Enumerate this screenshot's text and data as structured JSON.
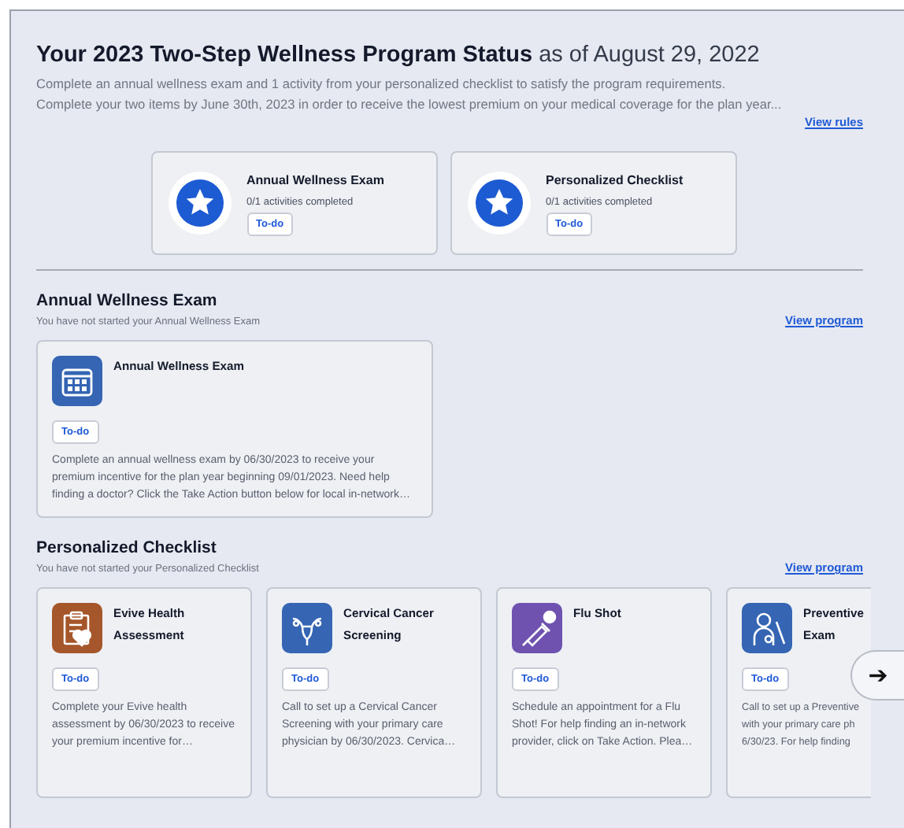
{
  "header": {
    "title": "Your 2023 Two-Step Wellness Program Status",
    "date": "as of August 29, 2022",
    "lines": [
      "Complete an annual wellness exam and 1 activity from your personalized checklist to satisfy the program requirements.",
      "Complete your two items by June 30th, 2023 in order to receive the lowest premium on your medical coverage for the plan year..."
    ],
    "link": "View rules"
  },
  "summary": [
    {
      "title": "Annual Wellness Exam",
      "progress": "0/1 activities completed",
      "status": "To-do"
    },
    {
      "title": "Personalized Checklist",
      "progress": "0/1 activities completed",
      "status": "To-do"
    }
  ],
  "sections": [
    {
      "title": "Annual Wellness Exam",
      "subtitle": "You have not started your Annual Wellness Exam",
      "link": "View program",
      "cards": [
        {
          "kind": "calendar",
          "color": "#3565b3",
          "title": "Annual Wellness Exam",
          "status": "To-do",
          "description": "Complete an annual wellness exam by 06/30/2023 to receive your premium incentive for the plan year beginning 09/01/2023. Need help finding a doctor? Click the Take Action button below for local in-network…",
          "clipped": false
        }
      ]
    },
    {
      "title": "Personalized Checklist",
      "subtitle": "You have not started your Personalized Checklist",
      "link": "View program",
      "cards": [
        {
          "kind": "clipboard",
          "color": "#a5562a",
          "title": "Evive Health Assessment",
          "status": "To-do",
          "description": "Complete your Evive health assessment by 06/30/2023 to receive your premium incentive for…",
          "clipped": false
        },
        {
          "kind": "uterus",
          "color": "#3565b3",
          "title": "Cervical Cancer Screening",
          "status": "To-do",
          "description": "Call to set up a Cervical Cancer Screening with your primary care physician by 06/30/2023. Cervica…",
          "clipped": false
        },
        {
          "kind": "syringe",
          "color": "#6f52b0",
          "title": "Flu Shot",
          "status": "To-do",
          "description": "Schedule an appointment for a Flu Shot! For help finding an in-network provider, click on Take Action. Plea…",
          "clipped": false
        },
        {
          "kind": "doctor",
          "color": "#3565b3",
          "title": "Preventive\nExam",
          "status": "To-do",
          "description": "Call to set up a Preventive\nwith your primary care ph\n6/30/23. For help finding",
          "clipped": true
        }
      ]
    }
  ],
  "next_button": "➔"
}
